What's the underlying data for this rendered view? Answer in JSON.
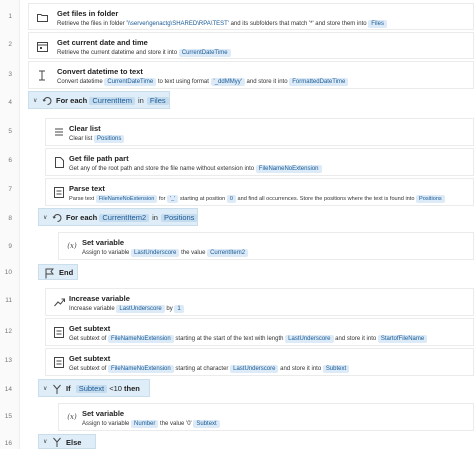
{
  "lines": [
    "1",
    "2",
    "3",
    "4",
    "5",
    "6",
    "7",
    "8",
    "9",
    "10",
    "11",
    "12",
    "13",
    "14",
    "15",
    "16"
  ],
  "actions": {
    "get_files": {
      "title": "Get files in folder",
      "desc_1": "Retrieve the files in folder",
      "folder": "'\\\\server\\genactg\\SHARED\\RPA\\TEST'",
      "desc_2": "and its subfolders that match '*' and store them into",
      "var": "Files"
    },
    "get_datetime": {
      "title": "Get current date and time",
      "desc": "Retrieve the current datetime and store it into",
      "var": "CurrentDateTime"
    },
    "convert_datetime": {
      "title": "Convert datetime to text",
      "desc_1": "Convert datetime",
      "var_1": "CurrentDateTime",
      "desc_2": "to text using format",
      "format": "'_ddMMyy'",
      "desc_3": "and store it into",
      "var_2": "FormattedDateTime"
    },
    "foreach_1": {
      "title": "For each",
      "var_1": "CurrentItem",
      "kw": "in",
      "var_2": "Files"
    },
    "clear_list": {
      "title": "Clear list",
      "desc": "Clear list",
      "var": "Positions"
    },
    "file_path_part": {
      "title": "Get file path part",
      "desc": "Get any of the root path and store the file name without extension into",
      "var": "FileNameNoExtension"
    },
    "parse_text": {
      "title": "Parse text",
      "desc_1": "Parse text",
      "var_1": "FileNameNoExtension",
      "desc_2": "for",
      "token": "'_'",
      "desc_3": "starting at position",
      "pos": "0",
      "desc_4": "and find all occurrences. Store the positions where the text is found into",
      "var_2": "Positions"
    },
    "foreach_2": {
      "title": "For each",
      "var_1": "CurrentItem2",
      "kw": "in",
      "var_2": "Positions"
    },
    "set_var_1": {
      "title": "Set variable",
      "desc_1": "Assign to variable",
      "var_1": "LastUnderscore",
      "desc_2": "the value",
      "var_2": "CurrentItem2"
    },
    "end": {
      "title": "End"
    },
    "increase_var": {
      "title": "Increase variable",
      "desc_1": "Increase variable",
      "var": "LastUnderscore",
      "desc_2": "by",
      "amount": "1"
    },
    "subtext_1": {
      "title": "Get subtext",
      "desc_1": "Get subtext of",
      "var_1": "FileNameNoExtension",
      "desc_2": "starting at the start of the text with length",
      "var_2": "LastUnderscore",
      "desc_3": "and store it into",
      "var_3": "StartofFileName"
    },
    "subtext_2": {
      "title": "Get subtext",
      "desc_1": "Get subtext of",
      "var_1": "FileNameNoExtension",
      "desc_2": "starting at character",
      "var_2": "LastUnderscore",
      "desc_3": "and store it into",
      "var_3": "Subtext"
    },
    "if_block": {
      "title": "If",
      "var": "Subtext",
      "op": "<10",
      "kw": "then"
    },
    "set_var_2": {
      "title": "Set variable",
      "desc_1": "Assign to variable",
      "var_1": "Number",
      "desc_2": "the value '0'",
      "var_2": "Subtext"
    },
    "else_block": {
      "title": "Else"
    }
  },
  "icons": {
    "get_files": "folder-icon",
    "get_datetime": "calendar-icon",
    "convert_datetime": "text-cursor-icon",
    "foreach": "loop-icon",
    "clear_list": "list-icon",
    "file_path_part": "file-icon",
    "parse_text": "document-icon",
    "set_var": "variable-icon",
    "end": "flag-icon",
    "increase_var": "trend-up-icon",
    "subtext": "document-icon",
    "if": "branch-icon",
    "else": "branch-icon"
  }
}
